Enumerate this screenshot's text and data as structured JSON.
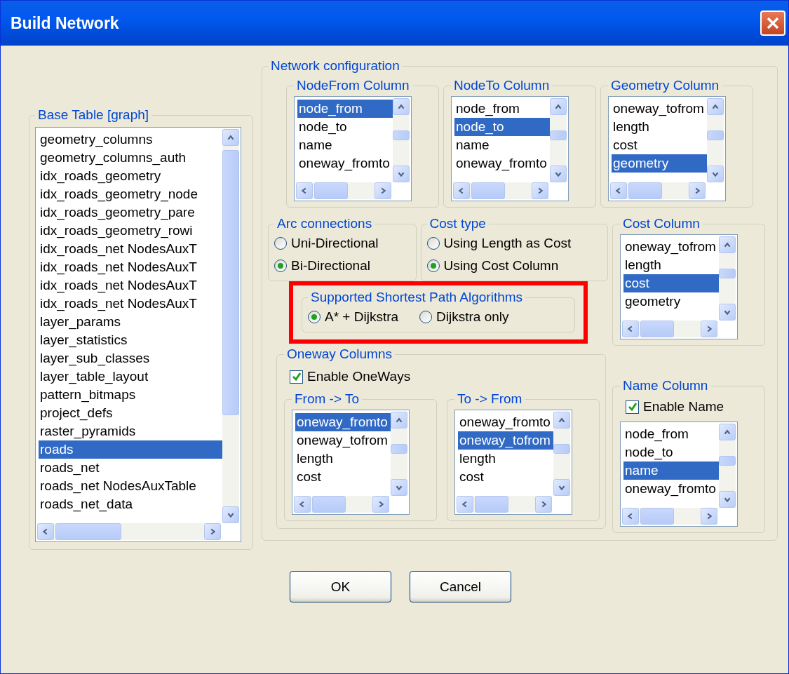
{
  "window": {
    "title": "Build Network"
  },
  "base_table": {
    "title": "Base Table [graph]",
    "items": [
      {
        "text": "geometry_columns",
        "selected": false
      },
      {
        "text": "geometry_columns_auth",
        "selected": false
      },
      {
        "text": "idx_roads_geometry",
        "selected": false
      },
      {
        "text": "idx_roads_geometry_node",
        "selected": false
      },
      {
        "text": "idx_roads_geometry_pare",
        "selected": false
      },
      {
        "text": "idx_roads_geometry_rowi",
        "selected": false
      },
      {
        "text": "idx_roads_net NodesAuxT",
        "selected": false
      },
      {
        "text": "idx_roads_net NodesAuxT",
        "selected": false
      },
      {
        "text": "idx_roads_net NodesAuxT",
        "selected": false
      },
      {
        "text": "idx_roads_net NodesAuxT",
        "selected": false
      },
      {
        "text": "layer_params",
        "selected": false
      },
      {
        "text": "layer_statistics",
        "selected": false
      },
      {
        "text": "layer_sub_classes",
        "selected": false
      },
      {
        "text": "layer_table_layout",
        "selected": false
      },
      {
        "text": "pattern_bitmaps",
        "selected": false
      },
      {
        "text": "project_defs",
        "selected": false
      },
      {
        "text": "raster_pyramids",
        "selected": false
      },
      {
        "text": "roads",
        "selected": true
      },
      {
        "text": "roads_net",
        "selected": false
      },
      {
        "text": "roads_net NodesAuxTable",
        "selected": false
      },
      {
        "text": "roads_net_data",
        "selected": false
      }
    ]
  },
  "network_configuration": {
    "title": "Network configuration",
    "nodefrom_column": {
      "title": "NodeFrom Column",
      "items": [
        {
          "text": "node_from",
          "selected": true
        },
        {
          "text": "node_to",
          "selected": false
        },
        {
          "text": "name",
          "selected": false
        },
        {
          "text": "oneway_fromto",
          "selected": false
        }
      ]
    },
    "nodeto_column": {
      "title": "NodeTo Column",
      "items": [
        {
          "text": "node_from",
          "selected": false
        },
        {
          "text": "node_to",
          "selected": true
        },
        {
          "text": "name",
          "selected": false
        },
        {
          "text": "oneway_fromto",
          "selected": false
        }
      ]
    },
    "geometry_column": {
      "title": "Geometry Column",
      "items": [
        {
          "text": "oneway_tofrom",
          "selected": false
        },
        {
          "text": "length",
          "selected": false
        },
        {
          "text": "cost",
          "selected": false
        },
        {
          "text": "geometry",
          "selected": true
        }
      ]
    },
    "arc_connections": {
      "title": "Arc connections",
      "options": [
        {
          "label": "Uni-Directional",
          "selected": false
        },
        {
          "label": "Bi-Directional",
          "selected": true
        }
      ]
    },
    "cost_type": {
      "title": "Cost type",
      "options": [
        {
          "label": "Using Length as Cost",
          "selected": false
        },
        {
          "label": "Using Cost Column",
          "selected": true
        }
      ]
    },
    "cost_column": {
      "title": "Cost Column",
      "items": [
        {
          "text": "oneway_tofrom",
          "selected": false
        },
        {
          "text": "length",
          "selected": false
        },
        {
          "text": "cost",
          "selected": true
        },
        {
          "text": "geometry",
          "selected": false
        }
      ]
    },
    "algorithms": {
      "title": "Supported Shortest Path Algorithms",
      "options": [
        {
          "label": "A* + Dijkstra",
          "selected": true
        },
        {
          "label": "Dijkstra only",
          "selected": false
        }
      ]
    },
    "oneway_columns": {
      "title": "Oneway Columns",
      "enable": {
        "label": "Enable OneWays",
        "checked": true
      },
      "from_to": {
        "title": "From -> To",
        "items": [
          {
            "text": "oneway_fromto",
            "selected": true
          },
          {
            "text": "oneway_tofrom",
            "selected": false
          },
          {
            "text": "length",
            "selected": false
          },
          {
            "text": "cost",
            "selected": false
          }
        ]
      },
      "to_from": {
        "title": "To -> From",
        "items": [
          {
            "text": "oneway_fromto",
            "selected": false
          },
          {
            "text": "oneway_tofrom",
            "selected": true
          },
          {
            "text": "length",
            "selected": false
          },
          {
            "text": "cost",
            "selected": false
          }
        ]
      }
    },
    "name_column": {
      "title": "Name Column",
      "enable": {
        "label": "Enable Name",
        "checked": true
      },
      "items": [
        {
          "text": "node_from",
          "selected": false
        },
        {
          "text": "node_to",
          "selected": false
        },
        {
          "text": "name",
          "selected": true
        },
        {
          "text": "oneway_fromto",
          "selected": false
        }
      ]
    }
  },
  "buttons": [
    "OK",
    "Cancel"
  ]
}
